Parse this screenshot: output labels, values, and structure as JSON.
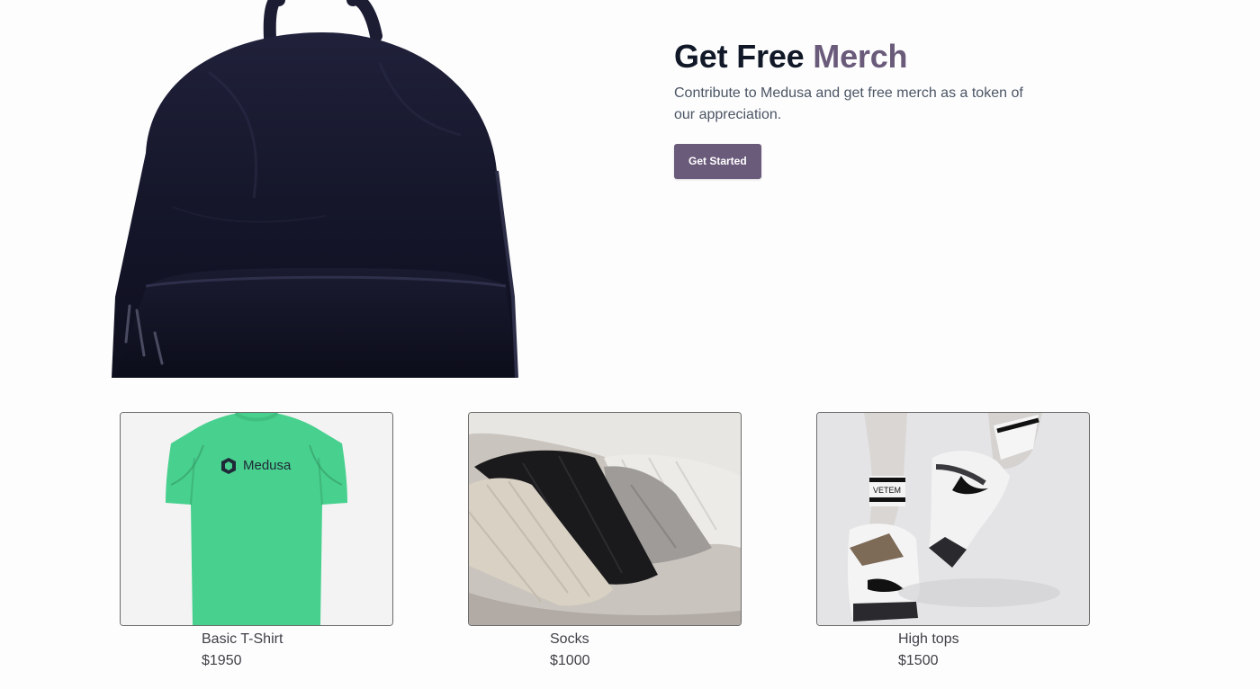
{
  "hero": {
    "title_part1": "Get Free",
    "title_accent": "Merch",
    "description": "Contribute to Medusa and get free merch as a token of our appreciation.",
    "cta_label": "Get Started",
    "image_icon": "backpack-image"
  },
  "colors": {
    "accent": "#6b5b7b",
    "background": "#fdfdfe",
    "tshirt_green": "#48d08e"
  },
  "products": [
    {
      "name": "Basic T-Shirt",
      "price": "$1950",
      "image_icon": "tshirt-image",
      "shirt_logo_text": "Medusa"
    },
    {
      "name": "Socks",
      "price": "$1000",
      "image_icon": "socks-image"
    },
    {
      "name": "High tops",
      "price": "$1500",
      "image_icon": "high-tops-image",
      "sock_brand_text": "VETEM"
    }
  ]
}
